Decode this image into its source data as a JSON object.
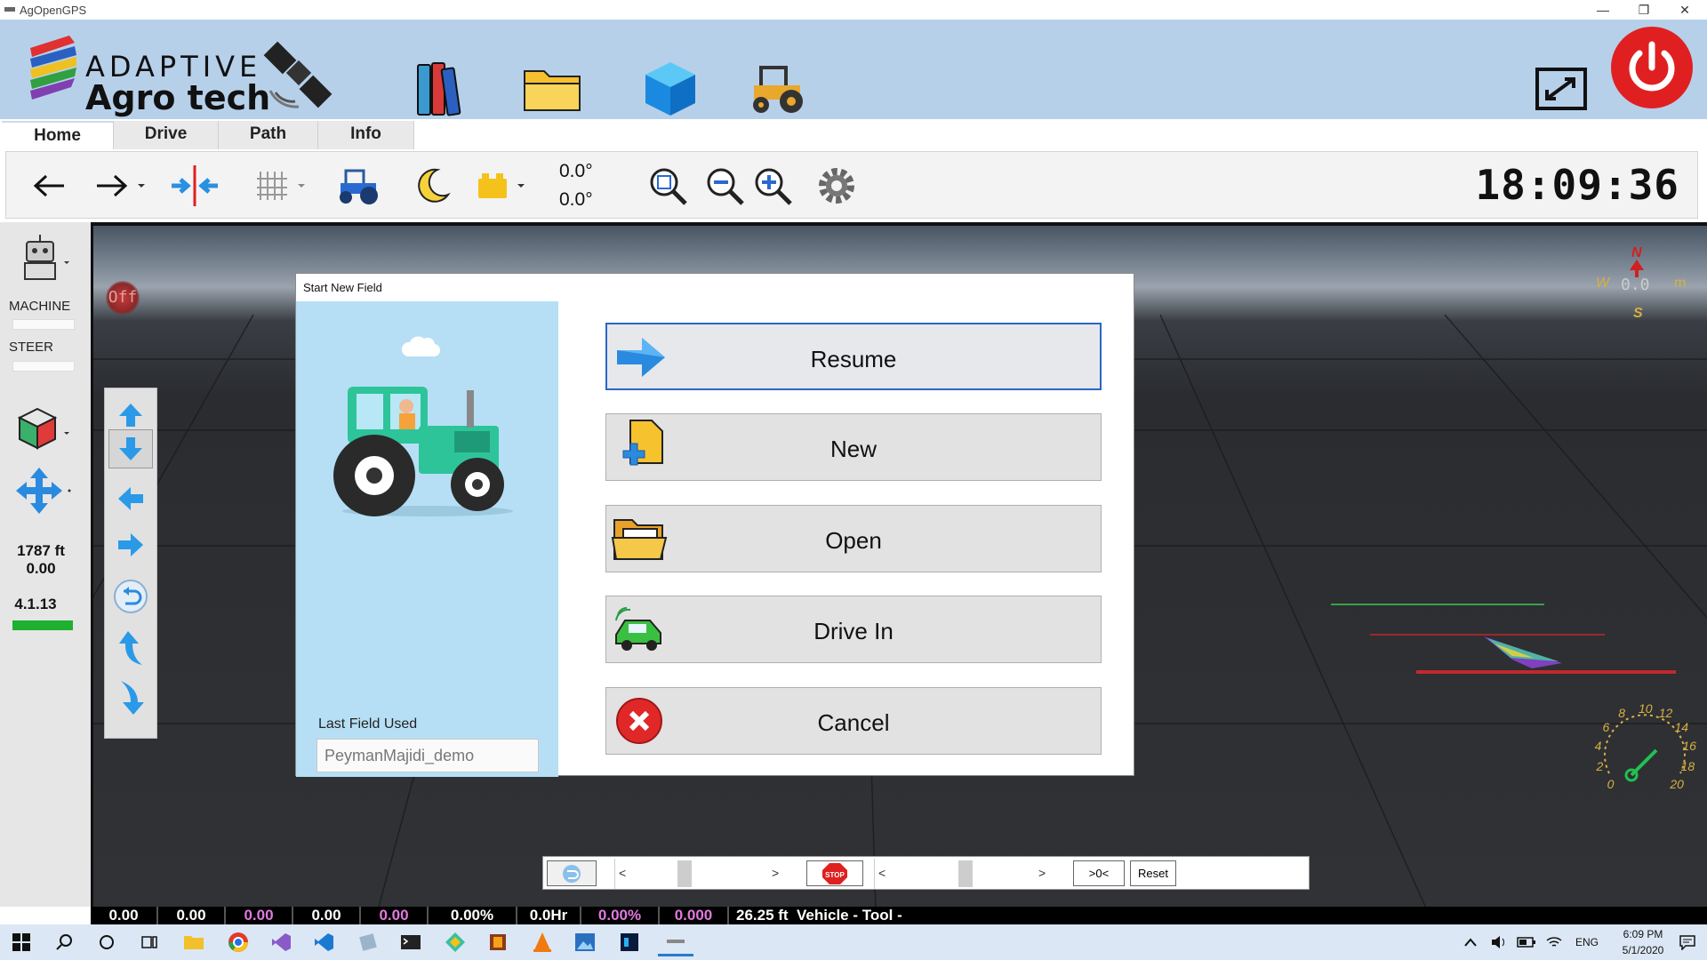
{
  "window": {
    "title": "AgOpenGPS",
    "min_symbol": "—",
    "restore_symbol": "❐",
    "close_symbol": "✕"
  },
  "header": {
    "logo_line1": "ADAPTIVE",
    "logo_line2": "Agro tech"
  },
  "tabs": [
    {
      "label": "Home",
      "active": true
    },
    {
      "label": "Drive",
      "active": false
    },
    {
      "label": "Path",
      "active": false
    },
    {
      "label": "Info",
      "active": false
    }
  ],
  "toolbar": {
    "angle1": "0.0°",
    "angle2": "0.0°",
    "clock": "18:09:36"
  },
  "left_panel": {
    "machine_label": "MACHINE",
    "steer_label": "STEER",
    "distance": "1787 ft",
    "distance_value": "0.00",
    "version": "4.1.13"
  },
  "viewport": {
    "off_label": "Off",
    "compass": {
      "north": "N",
      "south": "S",
      "west": "W",
      "readout": "0.0",
      "unit": "m"
    },
    "speedometer_ticks": [
      "0",
      "2",
      "4",
      "6",
      "8",
      "10",
      "12",
      "14",
      "16",
      "18",
      "20"
    ]
  },
  "dialog": {
    "title": "Start New Field",
    "last_field_label": "Last Field Used",
    "last_field_value": "PeymanMajidi_demo",
    "buttons": [
      {
        "label": "Resume",
        "icon": "arrow-right-icon"
      },
      {
        "label": "New",
        "icon": "new-file-icon"
      },
      {
        "label": "Open",
        "icon": "open-folder-icon"
      },
      {
        "label": "Drive In",
        "icon": "car-icon"
      },
      {
        "label": "Cancel",
        "icon": "cancel-icon"
      }
    ]
  },
  "control_strip": {
    "zero_label": ">0<",
    "reset_label": "Reset",
    "stop_label": "STOP",
    "left_arrow": "<",
    "right_arrow": ">"
  },
  "status_bar": {
    "cells": [
      {
        "text": "0.00",
        "magenta": false
      },
      {
        "text": "0.00",
        "magenta": false
      },
      {
        "text": "0.00",
        "magenta": true
      },
      {
        "text": "0.00",
        "magenta": false
      },
      {
        "text": "0.00",
        "magenta": true
      },
      {
        "text": "0.00%",
        "magenta": false
      },
      {
        "text": "0.0Hr",
        "magenta": false
      },
      {
        "text": "0.00%",
        "magenta": true
      },
      {
        "text": "0.000",
        "magenta": true
      }
    ],
    "tail": "26.25 ft  Vehicle - Tool -"
  },
  "taskbar": {
    "language": "ENG",
    "time": "6:09 PM",
    "date": "5/1/2020"
  },
  "colors": {
    "header_bg": "#b7d0ea",
    "dialog_left_bg": "#b6dff5",
    "focus_border": "#2a66c8",
    "power_red": "#e02020"
  }
}
